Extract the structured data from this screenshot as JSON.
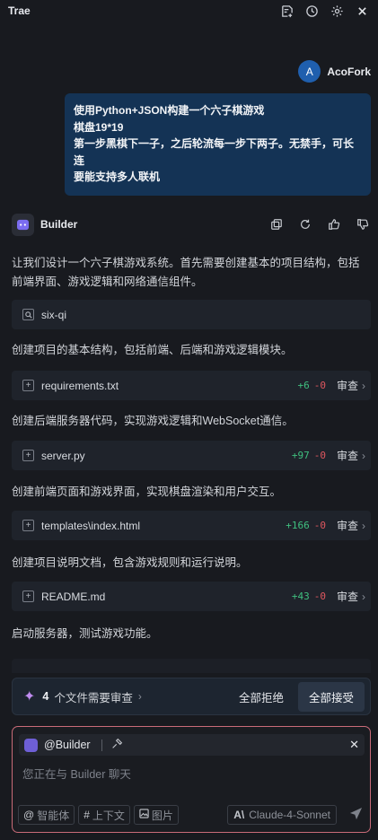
{
  "app": {
    "title": "Trae"
  },
  "header_icons": [
    "new-chat-icon",
    "history-icon",
    "settings-icon",
    "close-icon"
  ],
  "user": {
    "avatar_letter": "A",
    "name": "AcoFork"
  },
  "user_message": {
    "lines": [
      "使用Python+JSON构建一个六子棋游戏",
      "棋盘19*19",
      "第一步黑棋下一子，之后轮流每一步下两子。无禁手，可长连",
      "要能支持多人联机"
    ]
  },
  "builder": {
    "name": "Builder"
  },
  "steps": {
    "intro": "让我们设计一个六子棋游戏系统。首先需要创建基本的项目结构，包括前端界面、游戏逻辑和网络通信组件。",
    "search_term": "six-qi",
    "create_structure": "创建项目的基本结构，包括前端、后端和游戏逻辑模块。",
    "server_code": "创建后端服务器代码，实现游戏逻辑和WebSocket通信。",
    "frontend": "创建前端页面和游戏界面，实现棋盘渲染和用户交互。",
    "readme_desc": "创建项目说明文档，包含游戏规则和运行说明。",
    "start_server": "启动服务器，测试游戏功能。"
  },
  "files": [
    {
      "name": "requirements.txt",
      "added": "+6",
      "removed": "-0",
      "action": "审查"
    },
    {
      "name": "server.py",
      "added": "+97",
      "removed": "-0",
      "action": "审查"
    },
    {
      "name": "templates\\index.html",
      "added": "+166",
      "removed": "-0",
      "action": "审查"
    },
    {
      "name": "README.md",
      "added": "+43",
      "removed": "-0",
      "action": "审查"
    }
  ],
  "review_bar": {
    "count": "4",
    "text": "个文件需要审查",
    "reject_all": "全部拒绝",
    "accept_all": "全部接受"
  },
  "input": {
    "agent_chip": "@Builder",
    "placeholder": "您正在与 Builder 聊天",
    "tools": {
      "agent": "智能体",
      "context": "上下文",
      "image": "图片"
    },
    "model": "Claude-4-Sonnet"
  },
  "colors": {
    "added": "#3fbf7f",
    "removed": "#e0575f",
    "user_bubble": "#143355",
    "input_border": "#c96b78"
  }
}
